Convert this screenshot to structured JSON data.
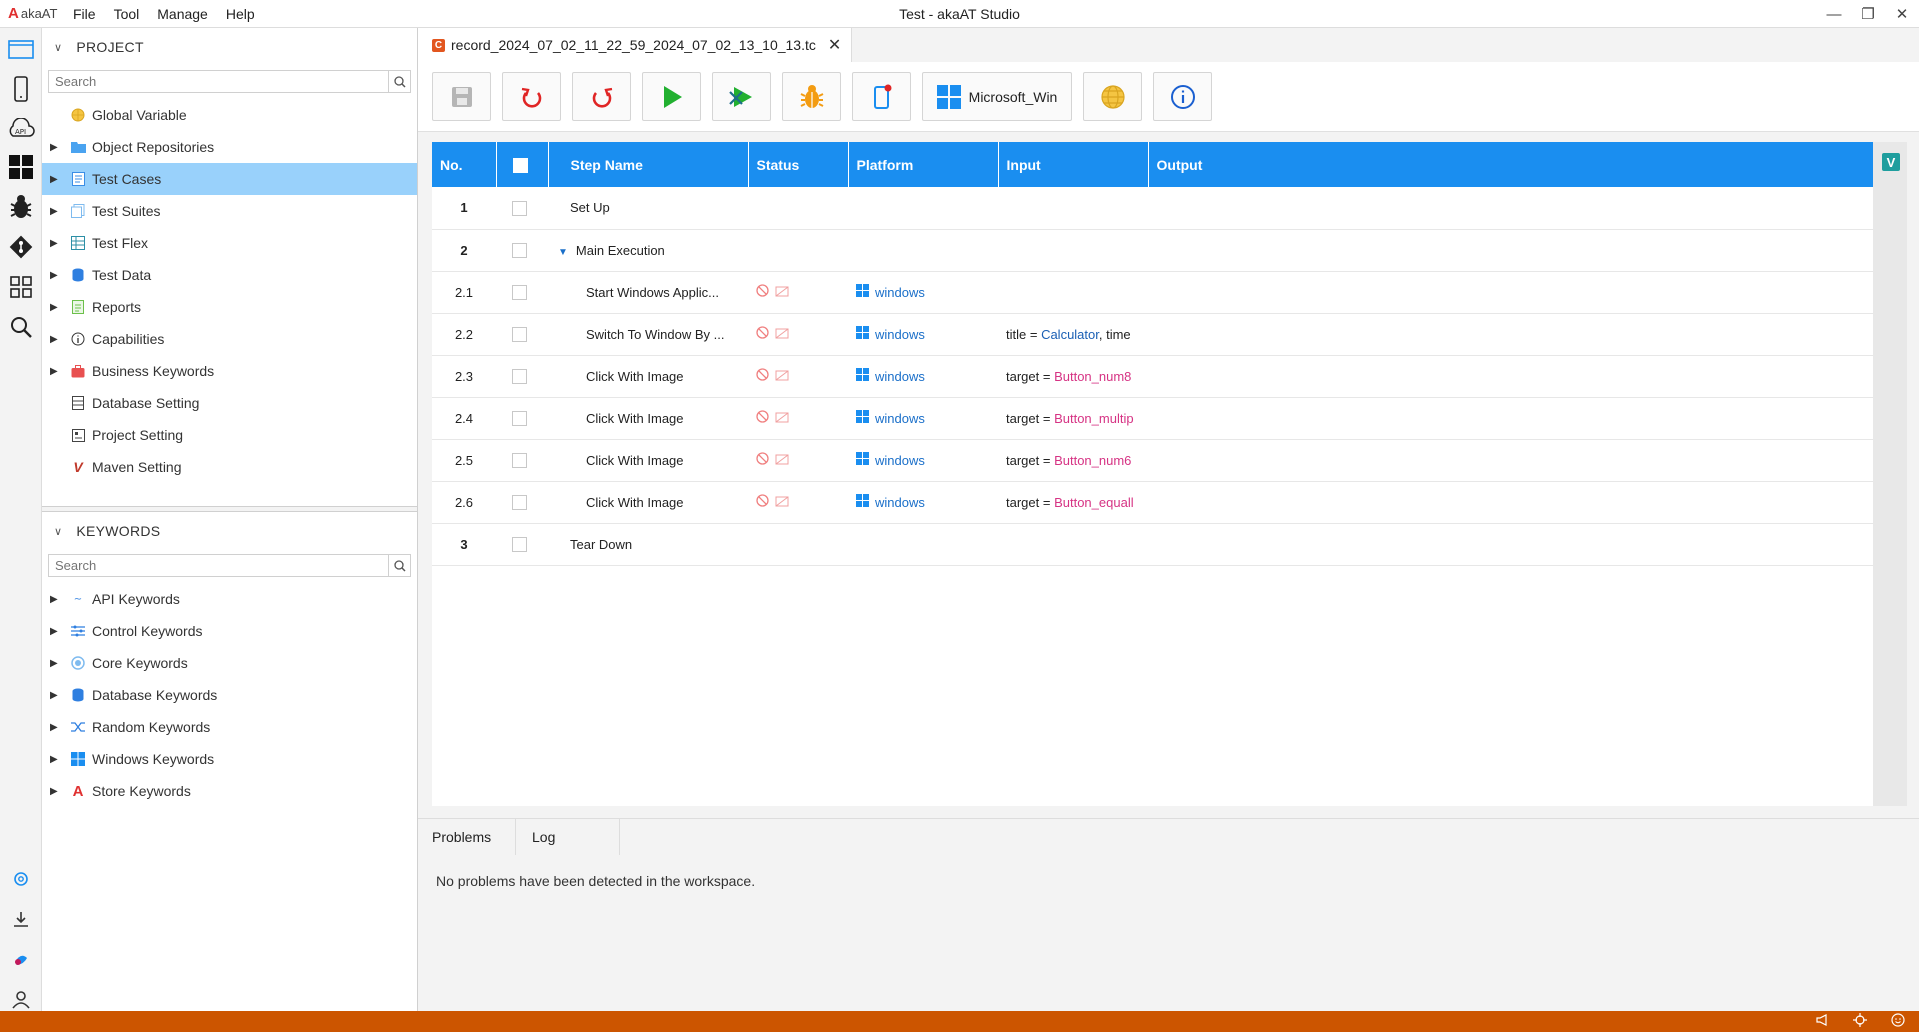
{
  "app": {
    "logo_text": "akaAT",
    "window_title": "Test - akaAT Studio",
    "menu": [
      "File",
      "Tool",
      "Manage",
      "Help"
    ]
  },
  "project": {
    "header": "PROJECT",
    "search_placeholder": "Search",
    "items": [
      {
        "label": "Global Variable",
        "icon": "globe-icon"
      },
      {
        "label": "Object Repositories",
        "icon": "folder-icon"
      },
      {
        "label": "Test Cases",
        "icon": "test-case-icon",
        "selected": true
      },
      {
        "label": "Test Suites",
        "icon": "test-suite-icon"
      },
      {
        "label": "Test Flex",
        "icon": "test-flex-icon"
      },
      {
        "label": "Test Data",
        "icon": "database-icon"
      },
      {
        "label": "Reports",
        "icon": "report-icon"
      },
      {
        "label": "Capabilities",
        "icon": "info-icon"
      },
      {
        "label": "Business Keywords",
        "icon": "briefcase-icon"
      },
      {
        "label": "Database Setting",
        "icon": "db-setting-icon"
      },
      {
        "label": "Project Setting",
        "icon": "project-setting-icon"
      },
      {
        "label": "Maven Setting",
        "icon": "maven-icon"
      }
    ]
  },
  "keywords": {
    "header": "KEYWORDS",
    "search_placeholder": "Search",
    "items": [
      {
        "label": "API Keywords",
        "icon": "api-icon"
      },
      {
        "label": "Control Keywords",
        "icon": "control-icon"
      },
      {
        "label": "Core Keywords",
        "icon": "core-icon"
      },
      {
        "label": "Database Keywords",
        "icon": "database-icon"
      },
      {
        "label": "Random Keywords",
        "icon": "shuffle-icon"
      },
      {
        "label": "Windows Keywords",
        "icon": "windows-icon"
      },
      {
        "label": "Store Keywords",
        "icon": "store-icon"
      }
    ]
  },
  "editor": {
    "tab_badge": "C",
    "tab_title": "record_2024_07_02_11_22_59_2024_07_02_13_10_13.tc",
    "platform_button": "Microsoft_Win",
    "columns": [
      "No.",
      "",
      "Step Name",
      "Status",
      "Platform",
      "Input",
      "Output"
    ],
    "rows": [
      {
        "no": "1",
        "name": "Set Up",
        "group": true
      },
      {
        "no": "2",
        "name": "Main Execution",
        "group": true,
        "expanded": true
      },
      {
        "no": "2.1",
        "name": "Start Windows Applic...",
        "platform": "windows",
        "input_key": "",
        "input_eq": "",
        "input_val": "",
        "input_rest": ""
      },
      {
        "no": "2.2",
        "name": "Switch To Window By ...",
        "platform": "windows",
        "input_key": "title",
        "input_eq": " = ",
        "input_val": "Calculator",
        "input_rest": ", time"
      },
      {
        "no": "2.3",
        "name": "Click With Image",
        "platform": "windows",
        "input_key": "target",
        "input_eq": " = ",
        "input_val": "Button_num8",
        "input_rest": ""
      },
      {
        "no": "2.4",
        "name": "Click With Image",
        "platform": "windows",
        "input_key": "target",
        "input_eq": " = ",
        "input_val": "Button_multip",
        "input_rest": ""
      },
      {
        "no": "2.5",
        "name": "Click With Image",
        "platform": "windows",
        "input_key": "target",
        "input_eq": " = ",
        "input_val": "Button_num6",
        "input_rest": ""
      },
      {
        "no": "2.6",
        "name": "Click With Image",
        "platform": "windows",
        "input_key": "target",
        "input_eq": " = ",
        "input_val": "Button_equall",
        "input_rest": ""
      },
      {
        "no": "3",
        "name": "Tear Down",
        "group": true
      }
    ],
    "side_badge": "V"
  },
  "bottom": {
    "tabs": [
      "Problems",
      "Log"
    ],
    "message": "No problems have been detected in the workspace."
  },
  "colors": {
    "accent": "#1a8ef0",
    "selection": "#99d1fb",
    "statusbar": "#cc5500"
  }
}
